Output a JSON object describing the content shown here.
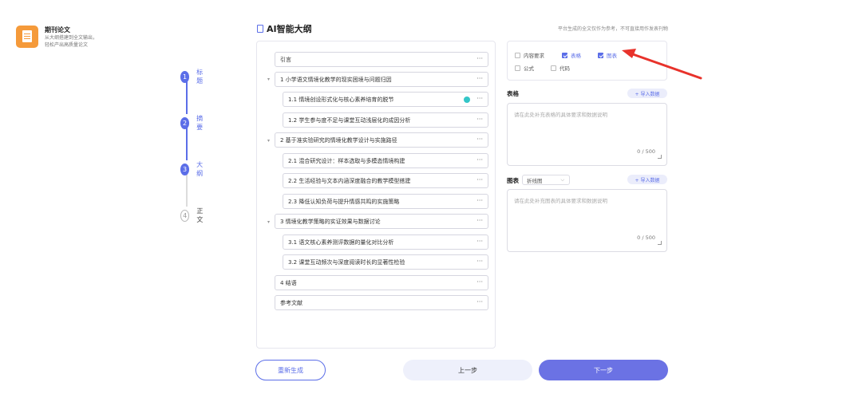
{
  "product": {
    "name": "期刊论文",
    "desc_line1": "从大纲搭建到全文输出，",
    "desc_line2": "轻松产出高质量论文"
  },
  "steps": [
    {
      "num": "1",
      "label": "标题",
      "state": "done"
    },
    {
      "num": "2",
      "label": "摘要",
      "state": "done"
    },
    {
      "num": "3",
      "label": "大纲",
      "state": "active"
    },
    {
      "num": "4",
      "label": "正文",
      "state": "todo"
    }
  ],
  "main": {
    "title": "AI智能大纲",
    "notice": "平台生成的全文仅作为参考，不可直接用作发表刊物"
  },
  "outline": {
    "more_icon": "···",
    "items": [
      {
        "text": "引言"
      },
      {
        "text": "1 小学语文情境化教学的现实困境与问题归因"
      },
      {
        "text": "1.1 情境创设形式化与核心素养培育的脱节"
      },
      {
        "text": "1.2 学生参与度不足与课堂互动浅层化的成因分析"
      },
      {
        "text": "2 基于准实验研究的情境化教学设计与实施路径"
      },
      {
        "text": "2.1 混合研究设计：样本选取与多模态情境构建"
      },
      {
        "text": "2.2 生活经验与文本内涵深度融合的教学模型搭建"
      },
      {
        "text": "2.3 降低认知负荷与提升情感共鸣的实施策略"
      },
      {
        "text": "3 情境化教学策略的实证效果与数据讨论"
      },
      {
        "text": "3.1 语文核心素养测评数据的量化对比分析"
      },
      {
        "text": "3.2 课堂互动频次与深度阅读时长的显著性检验"
      },
      {
        "text": "4 结语"
      },
      {
        "text": "参考文献"
      }
    ]
  },
  "options": {
    "content_req": {
      "label": "内容要求",
      "checked": false
    },
    "table": {
      "label": "表格",
      "checked": true
    },
    "chart": {
      "label": "图表",
      "checked": true
    },
    "formula": {
      "label": "公式",
      "checked": false
    },
    "code": {
      "label": "代码",
      "checked": false
    }
  },
  "table_section": {
    "title": "表格",
    "import_label": "+ 导入数据",
    "placeholder": "请在此处补充表格的具体要求和数据说明",
    "counter": "0 / 500"
  },
  "chart_section": {
    "title": "图表",
    "chart_type": "折线图",
    "import_label": "+ 导入数据",
    "placeholder": "请在此处补充图表的具体要求和数据说明",
    "counter": "0 / 500"
  },
  "buttons": {
    "regenerate": "重新生成",
    "prev": "上一步",
    "next": "下一步"
  },
  "colors": {
    "accent": "#5b6ee8",
    "arrow": "#e8322b",
    "ai_dot": "#34c6c8"
  }
}
